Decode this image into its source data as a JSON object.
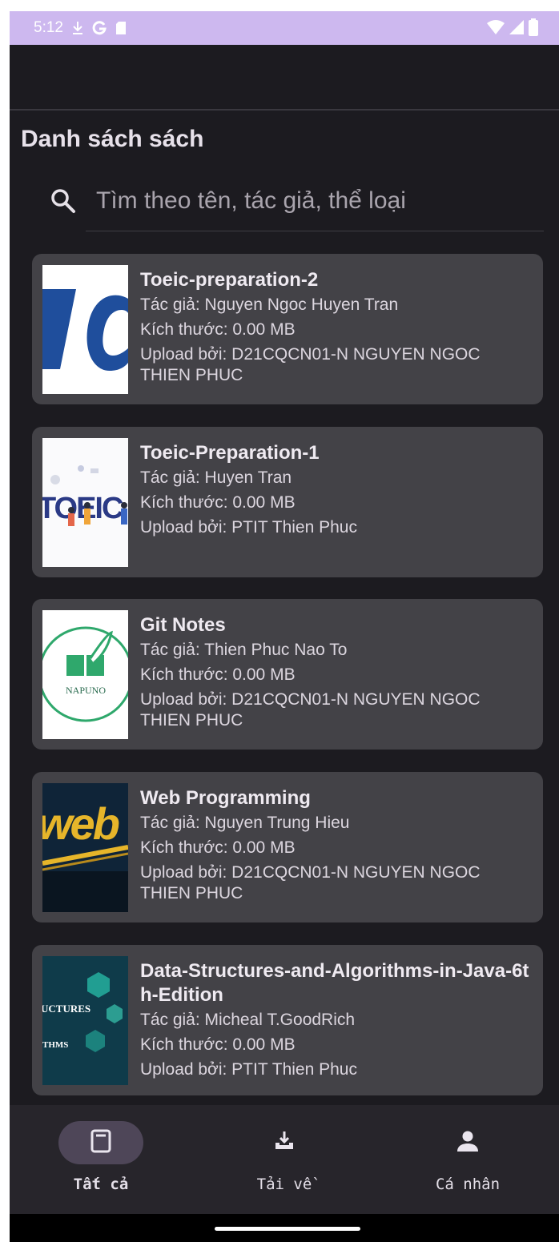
{
  "status_bar": {
    "time": "5:12",
    "icons": [
      "download-icon",
      "google-icon",
      "sd-card-icon",
      "wifi-icon",
      "signal-icon",
      "battery-icon"
    ]
  },
  "screen": {
    "title": "Danh sách sách",
    "search": {
      "placeholder": "Tìm theo tên, tác giả, thể loại"
    }
  },
  "books": [
    {
      "title": "Toeic-preparation-2",
      "author": "Tác giả: Nguyen Ngoc Huyen Tran",
      "size": "Kích thước: 0.00 MB",
      "uploader": "Upload bởi: D21CQCN01-N NGUYEN NGOC THIEN PHUC"
    },
    {
      "title": "Toeic-Preparation-1",
      "author": "Tác giả: Huyen Tran",
      "size": "Kích thước: 0.00 MB",
      "uploader": "Upload bởi: PTIT Thien Phuc",
      "cover_text": "TOEIC"
    },
    {
      "title": "Git Notes",
      "author": "Tác giả: Thien Phuc Nao To",
      "size": "Kích thước: 0.00 MB",
      "uploader": "Upload bởi: D21CQCN01-N NGUYEN NGOC THIEN PHUC",
      "cover_text": "NAPUNO"
    },
    {
      "title": "Web Programming",
      "author": "Tác giả: Nguyen Trung Hieu",
      "size": "Kích thước: 0.00 MB",
      "uploader": "Upload bởi: D21CQCN01-N NGUYEN NGOC THIEN PHUC",
      "cover_text": "web"
    },
    {
      "title": "Data-Structures-and-Algorithms-in-Java-6th-Edition",
      "author": "Tác giả: Micheal T.GoodRich",
      "size": "Kích thước: 0.00 MB",
      "uploader": "Upload bởi: PTIT Thien Phuc",
      "cover_text_1": "UCTURES",
      "cover_text_2": "THMS"
    }
  ],
  "bottom_nav": {
    "items": [
      {
        "label": "Tất cả",
        "icon": "book-icon",
        "active": true
      },
      {
        "label": "Tải về",
        "icon": "download-tray-icon",
        "active": false
      },
      {
        "label": "Cá nhân",
        "icon": "person-icon",
        "active": false
      }
    ]
  },
  "colors": {
    "status_bar": "#cdb8ef",
    "background": "#1c1b20",
    "card": "#434247",
    "nav_bar": "#27252b",
    "active_pill": "#4e4658"
  }
}
